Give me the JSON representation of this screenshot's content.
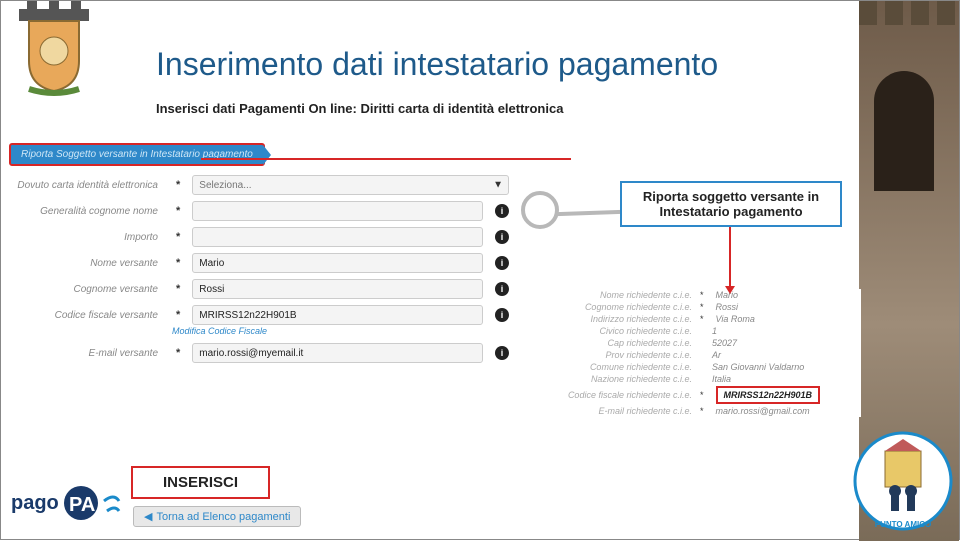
{
  "title": "Inserimento dati intestatario pagamento",
  "subtitle": "Inserisci dati Pagamenti On line: Diritti carta di identità elettronica",
  "ribbon": "Riporta Soggetto versante in Intestatario pagamento",
  "callout": {
    "line1": "Riporta soggetto versante in",
    "line2": "Intestatario pagamento"
  },
  "form": {
    "dovuto_label": "Dovuto carta identità elettronica",
    "dovuto_placeholder": "Seleziona...",
    "generalita_label": "Generalità cognome nome",
    "importo_label": "Importo",
    "nome_label": "Nome versante",
    "nome_value": "Mario",
    "cognome_label": "Cognome versante",
    "cognome_value": "Rossi",
    "cf_label": "Codice fiscale versante",
    "cf_value": "MRIRSS12n22H901B",
    "cf_link": "Modifica Codice Fiscale",
    "email_label": "E-mail versante",
    "email_value": "mario.rossi@myemail.it"
  },
  "details": {
    "nome": {
      "label": "Nome richiedente c.i.e.",
      "value": "Mario"
    },
    "cognome": {
      "label": "Cognome richiedente c.i.e.",
      "value": "Rossi"
    },
    "indirizzo": {
      "label": "Indirizzo richiedente c.i.e.",
      "value": "Via Roma"
    },
    "civico": {
      "label": "Civico richiedente c.i.e.",
      "value": "1"
    },
    "cap": {
      "label": "Cap richiedente c.i.e.",
      "value": "52027"
    },
    "prov": {
      "label": "Prov richiedente c.i.e.",
      "value": "Ar"
    },
    "comune": {
      "label": "Comune richiedente c.i.e.",
      "value": "San Giovanni Valdarno"
    },
    "nazione": {
      "label": "Nazione richiedente c.i.e.",
      "value": "Italia"
    },
    "cf": {
      "label": "Codice fiscale richiedente c.i.e.",
      "value": "MRIRSS12n22H901B"
    },
    "email": {
      "label": "E-mail richiedente c.i.e.",
      "value": "mario.rossi@gmail.com"
    }
  },
  "buttons": {
    "inserisci": "INSERISCI",
    "back": "Torna ad Elenco pagamenti"
  },
  "logos": {
    "pagopa": "pagoPA",
    "punto": "PUNTO AMICO"
  }
}
